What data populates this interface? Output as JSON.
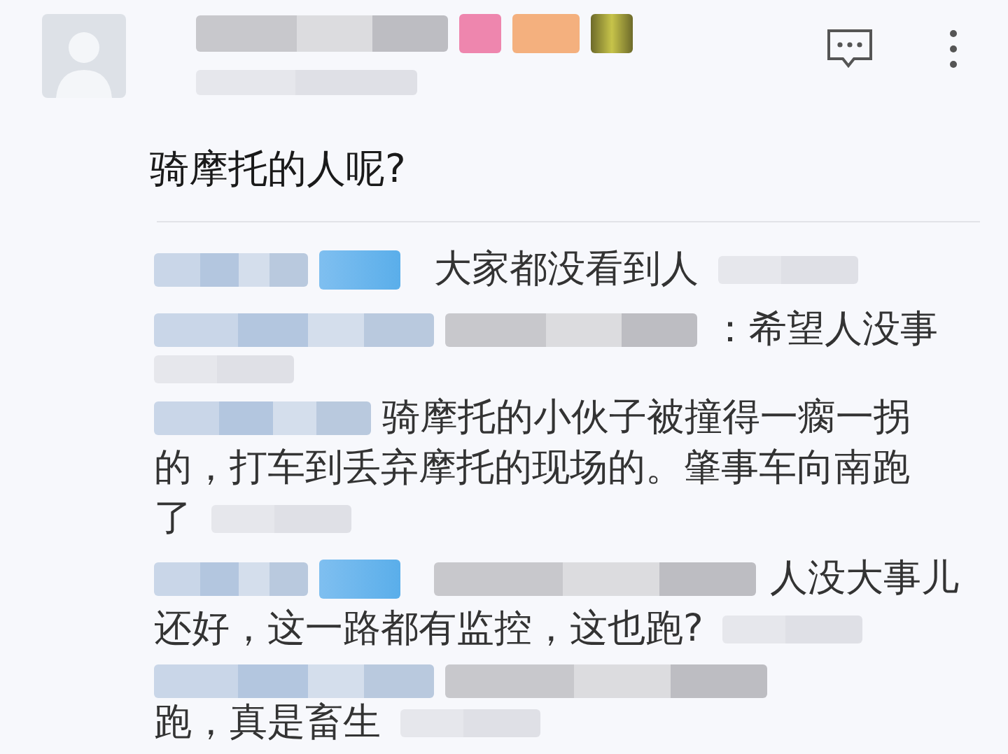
{
  "post": {
    "text": "骑摩托的人呢?"
  },
  "replies": [
    {
      "badge": true,
      "lines": [
        "大家都没看到人"
      ]
    },
    {
      "badge": false,
      "lines": [
        "：希望人没事"
      ]
    },
    {
      "badge": false,
      "lines": [
        "骑摩托的小伙子被撞得一瘸一拐",
        "的，打车到丢弃摩托的现场的。肇事车向南跑",
        "了"
      ]
    },
    {
      "badge": true,
      "lines": [
        "人没大事儿",
        "还好，这一路都有监控，这也跑?"
      ]
    },
    {
      "badge": false,
      "lines": [
        "跑，真是畜生"
      ]
    }
  ]
}
